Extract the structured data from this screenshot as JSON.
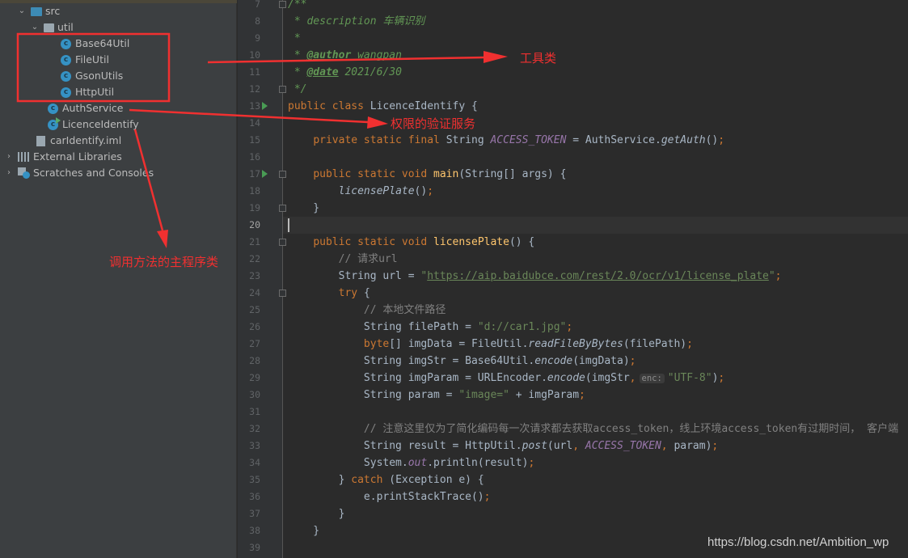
{
  "project_tree": {
    "src": "src",
    "util": "util",
    "util_classes": [
      "Base64Util",
      "FileUtil",
      "GsonUtils",
      "HttpUtil"
    ],
    "auth_service": "AuthService",
    "licence_identify": "LicenceIdentify",
    "iml_file": "carIdentify.iml",
    "external_libraries": "External Libraries",
    "scratches": "Scratches and Consoles"
  },
  "annotations": {
    "tools": "工具类",
    "auth": "权限的验证服务",
    "main": "调用方法的主程序类",
    "color": "#f03030"
  },
  "editor": {
    "current_line": 20,
    "first_line": 7,
    "lines": [
      [
        [
          "doc",
          "/**"
        ]
      ],
      [
        [
          "doc",
          " * description 车辆识别"
        ]
      ],
      [
        [
          "doc",
          " *"
        ]
      ],
      [
        [
          "doc",
          " * "
        ],
        [
          "tag",
          "@author"
        ],
        [
          "doc",
          " wangpan"
        ]
      ],
      [
        [
          "doc",
          " * "
        ],
        [
          "tag",
          "@date"
        ],
        [
          "doc",
          " 2021/6/30"
        ]
      ],
      [
        [
          "doc",
          " */"
        ]
      ],
      [
        [
          "kw",
          "public class "
        ],
        [
          "",
          "LicenceIdentify {"
        ]
      ],
      [],
      [
        [
          "",
          "    "
        ],
        [
          "kw",
          "private static final "
        ],
        [
          "",
          "String "
        ],
        [
          "sf",
          "ACCESS_TOKEN"
        ],
        [
          "",
          " = AuthService."
        ],
        [
          "sm",
          "getAuth"
        ],
        [
          "",
          "()"
        ],
        [
          "kw",
          ";"
        ]
      ],
      [],
      [
        [
          "",
          "    "
        ],
        [
          "kw",
          "public static void "
        ],
        [
          "fn",
          "main"
        ],
        [
          "",
          "(String[] args) {"
        ]
      ],
      [
        [
          "",
          "        "
        ],
        [
          "sm",
          "licensePlate"
        ],
        [
          "",
          "()"
        ],
        [
          "kw",
          ";"
        ]
      ],
      [
        [
          "",
          "    }"
        ]
      ],
      [],
      [
        [
          "",
          "    "
        ],
        [
          "kw",
          "public static void "
        ],
        [
          "fn",
          "licensePlate"
        ],
        [
          "",
          "() {"
        ]
      ],
      [
        [
          "",
          "        "
        ],
        [
          "cm",
          "// 请求url"
        ]
      ],
      [
        [
          "",
          "        String url = "
        ],
        [
          "str",
          "\""
        ],
        [
          "url",
          "https://aip.baidubce.com/rest/2.0/ocr/v1/license_plate"
        ],
        [
          "str",
          "\""
        ],
        [
          "kw",
          ";"
        ]
      ],
      [
        [
          "",
          "        "
        ],
        [
          "kw",
          "try "
        ],
        [
          "",
          "{"
        ]
      ],
      [
        [
          "",
          "            "
        ],
        [
          "cm",
          "// 本地文件路径"
        ]
      ],
      [
        [
          "",
          "            String filePath = "
        ],
        [
          "str",
          "\"d://car1.jpg\""
        ],
        [
          "kw",
          ";"
        ]
      ],
      [
        [
          "",
          "            "
        ],
        [
          "kw",
          "byte"
        ],
        [
          "",
          "[] imgData = FileUtil."
        ],
        [
          "sm",
          "readFileByBytes"
        ],
        [
          "",
          "(filePath)"
        ],
        [
          "kw",
          ";"
        ]
      ],
      [
        [
          "",
          "            String imgStr = Base64Util."
        ],
        [
          "sm",
          "encode"
        ],
        [
          "",
          "(imgData)"
        ],
        [
          "kw",
          ";"
        ]
      ],
      [
        [
          "",
          "            String imgParam = URLEncoder."
        ],
        [
          "sm",
          "encode"
        ],
        [
          "",
          "(imgStr"
        ],
        [
          "kw",
          ","
        ],
        [
          "hint",
          "enc:"
        ],
        [
          "str",
          "\"UTF-8\""
        ],
        [
          "",
          ")"
        ],
        [
          "kw",
          ";"
        ]
      ],
      [
        [
          "",
          "            String param = "
        ],
        [
          "str",
          "\"image=\""
        ],
        [
          "",
          " + imgParam"
        ],
        [
          "kw",
          ";"
        ]
      ],
      [],
      [
        [
          "",
          "            "
        ],
        [
          "cm",
          "// 注意这里仅为了简化编码每一次请求都去获取access_token，线上环境access_token有过期时间， 客户端"
        ]
      ],
      [
        [
          "",
          "            String result = HttpUtil."
        ],
        [
          "sm",
          "post"
        ],
        [
          "",
          "(url"
        ],
        [
          "kw",
          ", "
        ],
        [
          "sf",
          "ACCESS_TOKEN"
        ],
        [
          "kw",
          ", "
        ],
        [
          "",
          "param)"
        ],
        [
          "kw",
          ";"
        ]
      ],
      [
        [
          "",
          "            System."
        ],
        [
          "sf",
          "out"
        ],
        [
          "",
          ".println(result)"
        ],
        [
          "kw",
          ";"
        ]
      ],
      [
        [
          "",
          "        } "
        ],
        [
          "kw",
          "catch "
        ],
        [
          "",
          "(Exception e) {"
        ]
      ],
      [
        [
          "",
          "            e.printStackTrace()"
        ],
        [
          "kw",
          ";"
        ]
      ],
      [
        [
          "",
          "        }"
        ]
      ],
      [
        [
          "",
          "    }"
        ]
      ],
      []
    ],
    "run_lines": [
      13,
      17
    ],
    "fold_lines": [
      7,
      12,
      17,
      19,
      21,
      24
    ]
  },
  "watermark": "https://blog.csdn.net/Ambition_wp"
}
